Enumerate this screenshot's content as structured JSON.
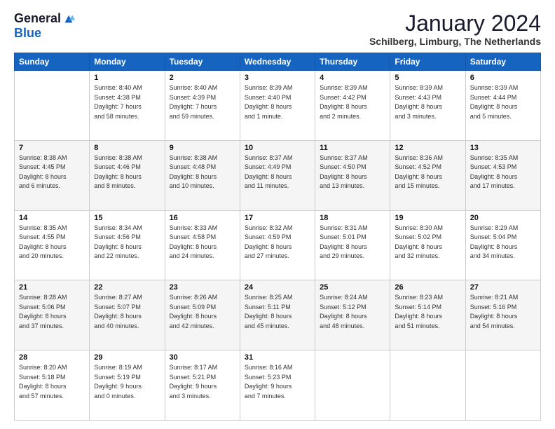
{
  "header": {
    "logo_general": "General",
    "logo_blue": "Blue",
    "month_title": "January 2024",
    "location": "Schilberg, Limburg, The Netherlands"
  },
  "days_of_week": [
    "Sunday",
    "Monday",
    "Tuesday",
    "Wednesday",
    "Thursday",
    "Friday",
    "Saturday"
  ],
  "weeks": [
    [
      {
        "day": "",
        "info": ""
      },
      {
        "day": "1",
        "info": "Sunrise: 8:40 AM\nSunset: 4:38 PM\nDaylight: 7 hours\nand 58 minutes."
      },
      {
        "day": "2",
        "info": "Sunrise: 8:40 AM\nSunset: 4:39 PM\nDaylight: 7 hours\nand 59 minutes."
      },
      {
        "day": "3",
        "info": "Sunrise: 8:39 AM\nSunset: 4:40 PM\nDaylight: 8 hours\nand 1 minute."
      },
      {
        "day": "4",
        "info": "Sunrise: 8:39 AM\nSunset: 4:42 PM\nDaylight: 8 hours\nand 2 minutes."
      },
      {
        "day": "5",
        "info": "Sunrise: 8:39 AM\nSunset: 4:43 PM\nDaylight: 8 hours\nand 3 minutes."
      },
      {
        "day": "6",
        "info": "Sunrise: 8:39 AM\nSunset: 4:44 PM\nDaylight: 8 hours\nand 5 minutes."
      }
    ],
    [
      {
        "day": "7",
        "info": "Sunrise: 8:38 AM\nSunset: 4:45 PM\nDaylight: 8 hours\nand 6 minutes."
      },
      {
        "day": "8",
        "info": "Sunrise: 8:38 AM\nSunset: 4:46 PM\nDaylight: 8 hours\nand 8 minutes."
      },
      {
        "day": "9",
        "info": "Sunrise: 8:38 AM\nSunset: 4:48 PM\nDaylight: 8 hours\nand 10 minutes."
      },
      {
        "day": "10",
        "info": "Sunrise: 8:37 AM\nSunset: 4:49 PM\nDaylight: 8 hours\nand 11 minutes."
      },
      {
        "day": "11",
        "info": "Sunrise: 8:37 AM\nSunset: 4:50 PM\nDaylight: 8 hours\nand 13 minutes."
      },
      {
        "day": "12",
        "info": "Sunrise: 8:36 AM\nSunset: 4:52 PM\nDaylight: 8 hours\nand 15 minutes."
      },
      {
        "day": "13",
        "info": "Sunrise: 8:35 AM\nSunset: 4:53 PM\nDaylight: 8 hours\nand 17 minutes."
      }
    ],
    [
      {
        "day": "14",
        "info": "Sunrise: 8:35 AM\nSunset: 4:55 PM\nDaylight: 8 hours\nand 20 minutes."
      },
      {
        "day": "15",
        "info": "Sunrise: 8:34 AM\nSunset: 4:56 PM\nDaylight: 8 hours\nand 22 minutes."
      },
      {
        "day": "16",
        "info": "Sunrise: 8:33 AM\nSunset: 4:58 PM\nDaylight: 8 hours\nand 24 minutes."
      },
      {
        "day": "17",
        "info": "Sunrise: 8:32 AM\nSunset: 4:59 PM\nDaylight: 8 hours\nand 27 minutes."
      },
      {
        "day": "18",
        "info": "Sunrise: 8:31 AM\nSunset: 5:01 PM\nDaylight: 8 hours\nand 29 minutes."
      },
      {
        "day": "19",
        "info": "Sunrise: 8:30 AM\nSunset: 5:02 PM\nDaylight: 8 hours\nand 32 minutes."
      },
      {
        "day": "20",
        "info": "Sunrise: 8:29 AM\nSunset: 5:04 PM\nDaylight: 8 hours\nand 34 minutes."
      }
    ],
    [
      {
        "day": "21",
        "info": "Sunrise: 8:28 AM\nSunset: 5:06 PM\nDaylight: 8 hours\nand 37 minutes."
      },
      {
        "day": "22",
        "info": "Sunrise: 8:27 AM\nSunset: 5:07 PM\nDaylight: 8 hours\nand 40 minutes."
      },
      {
        "day": "23",
        "info": "Sunrise: 8:26 AM\nSunset: 5:09 PM\nDaylight: 8 hours\nand 42 minutes."
      },
      {
        "day": "24",
        "info": "Sunrise: 8:25 AM\nSunset: 5:11 PM\nDaylight: 8 hours\nand 45 minutes."
      },
      {
        "day": "25",
        "info": "Sunrise: 8:24 AM\nSunset: 5:12 PM\nDaylight: 8 hours\nand 48 minutes."
      },
      {
        "day": "26",
        "info": "Sunrise: 8:23 AM\nSunset: 5:14 PM\nDaylight: 8 hours\nand 51 minutes."
      },
      {
        "day": "27",
        "info": "Sunrise: 8:21 AM\nSunset: 5:16 PM\nDaylight: 8 hours\nand 54 minutes."
      }
    ],
    [
      {
        "day": "28",
        "info": "Sunrise: 8:20 AM\nSunset: 5:18 PM\nDaylight: 8 hours\nand 57 minutes."
      },
      {
        "day": "29",
        "info": "Sunrise: 8:19 AM\nSunset: 5:19 PM\nDaylight: 9 hours\nand 0 minutes."
      },
      {
        "day": "30",
        "info": "Sunrise: 8:17 AM\nSunset: 5:21 PM\nDaylight: 9 hours\nand 3 minutes."
      },
      {
        "day": "31",
        "info": "Sunrise: 8:16 AM\nSunset: 5:23 PM\nDaylight: 9 hours\nand 7 minutes."
      },
      {
        "day": "",
        "info": ""
      },
      {
        "day": "",
        "info": ""
      },
      {
        "day": "",
        "info": ""
      }
    ]
  ]
}
